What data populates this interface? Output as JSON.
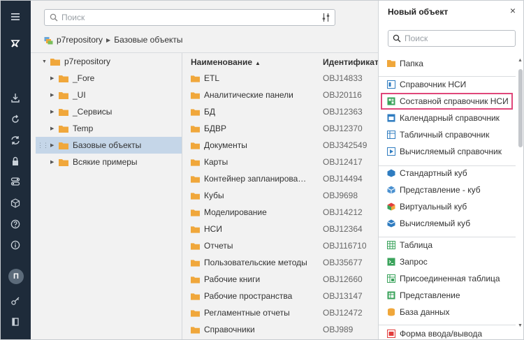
{
  "colors": {
    "rail": "#1e2b3a",
    "folder": "#f0a73b",
    "highlight": "#e0477a",
    "selected_row": "#c5d6e8"
  },
  "rail": {
    "icons": [
      "menu-icon",
      "logo-icon",
      "import-icon",
      "refresh-icon",
      "sync-icon",
      "lock-icon",
      "settings-toggle-icon",
      "cube-icon",
      "help-icon",
      "info-icon",
      "avatar",
      "key-icon",
      "book-icon"
    ],
    "avatar_letter": "П"
  },
  "search": {
    "placeholder": "Поиск",
    "value": ""
  },
  "breadcrumb": {
    "repo": "p7repository",
    "current": "Базовые объекты"
  },
  "tree": {
    "root": "p7repository",
    "items": [
      "_Fore",
      "_UI",
      "_Сервисы",
      "Temp",
      "Базовые объекты",
      "Всякие примеры"
    ],
    "selected": "Базовые объекты"
  },
  "list": {
    "columns": {
      "name": "Наименование",
      "id": "Идентификатор"
    },
    "rows": [
      {
        "name": "ETL",
        "id": "OBJ14833"
      },
      {
        "name": "Аналитические панели",
        "id": "OBJ20116"
      },
      {
        "name": "БД",
        "id": "OBJ12363"
      },
      {
        "name": "БДВР",
        "id": "OBJ12370"
      },
      {
        "name": "Документы",
        "id": "OBJ342549"
      },
      {
        "name": "Карты",
        "id": "OBJ12417"
      },
      {
        "name": "Контейнер запланированны...",
        "id": "OBJ14494"
      },
      {
        "name": "Кубы",
        "id": "OBJ9698"
      },
      {
        "name": "Моделирование",
        "id": "OBJ14212"
      },
      {
        "name": "НСИ",
        "id": "OBJ12364"
      },
      {
        "name": "Отчеты",
        "id": "OBJ116710"
      },
      {
        "name": "Пользовательские методы",
        "id": "OBJ35677"
      },
      {
        "name": "Рабочие книги",
        "id": "OBJ12660"
      },
      {
        "name": "Рабочие пространства",
        "id": "OBJ13147"
      },
      {
        "name": "Регламентные отчеты",
        "id": "OBJ12472"
      },
      {
        "name": "Справочники",
        "id": "OBJ989"
      }
    ]
  },
  "side_panel": {
    "title": "Новый объект",
    "close": "×",
    "search_placeholder": "Поиск",
    "items": [
      {
        "label": "Папка",
        "icon": "folder-icon"
      },
      {
        "label": "Справочник НСИ",
        "icon": "dictionary-icon"
      },
      {
        "label": "Составной справочник НСИ",
        "icon": "composite-dictionary-icon"
      },
      {
        "label": "Календарный справочник",
        "icon": "calendar-dictionary-icon"
      },
      {
        "label": "Табличный справочник",
        "icon": "table-dictionary-icon"
      },
      {
        "label": "Вычисляемый справочник",
        "icon": "computed-dictionary-icon"
      },
      {
        "label": "Стандартный куб",
        "icon": "standard-cube-icon"
      },
      {
        "label": "Представление - куб",
        "icon": "view-cube-icon"
      },
      {
        "label": "Виртуальный куб",
        "icon": "virtual-cube-icon"
      },
      {
        "label": "Вычисляемый куб",
        "icon": "computed-cube-icon"
      },
      {
        "label": "Таблица",
        "icon": "table-icon"
      },
      {
        "label": "Запрос",
        "icon": "query-icon"
      },
      {
        "label": "Присоединенная таблица",
        "icon": "linked-table-icon"
      },
      {
        "label": "Представление",
        "icon": "view-icon"
      },
      {
        "label": "База данных",
        "icon": "database-icon"
      },
      {
        "label": "Форма ввода/вывода",
        "icon": "io-form-icon"
      }
    ],
    "highlighted": "Составной справочник НСИ"
  }
}
